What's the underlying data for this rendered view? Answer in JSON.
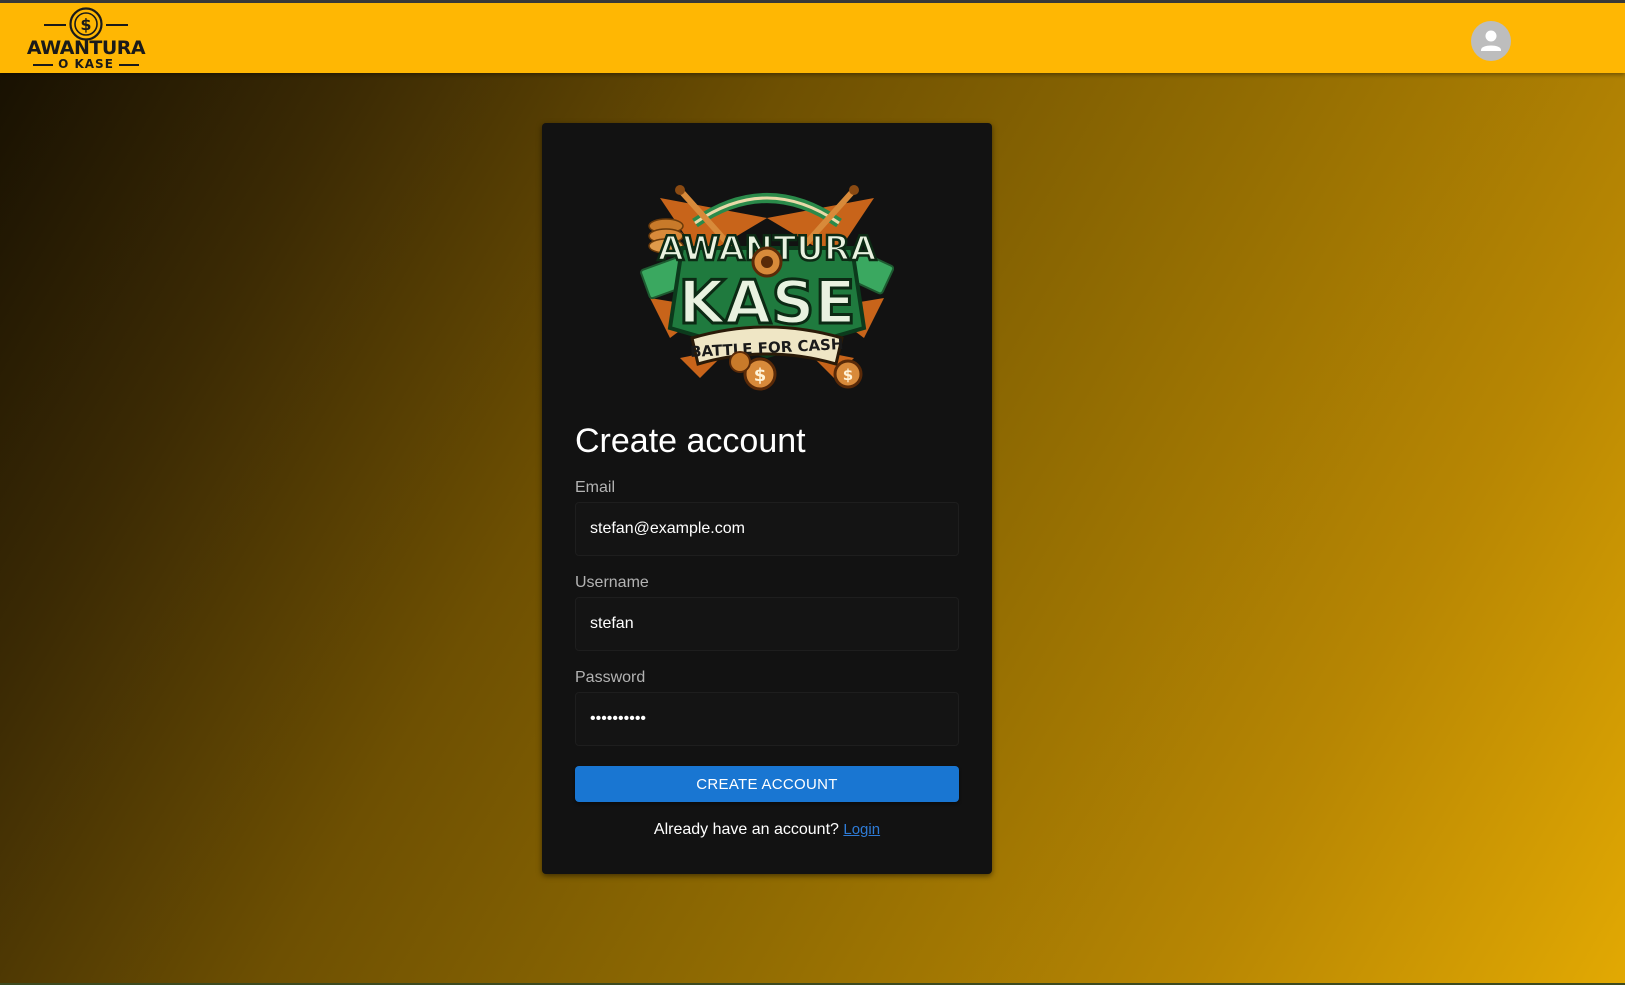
{
  "header": {
    "brand_word": "AWANTURA",
    "brand_sub": "O KASE",
    "avatar_icon": "account-icon",
    "accent_color": "#ffb703"
  },
  "card": {
    "logo": {
      "line1": "AWANTURA",
      "line2": "KASE",
      "tagline": "BATTLE FOR CASH"
    },
    "title": "Create account",
    "email": {
      "label": "Email",
      "value": "stefan@example.com"
    },
    "username": {
      "label": "Username",
      "value": "stefan"
    },
    "password": {
      "label": "Password",
      "value": "••••••••••"
    },
    "submit_label": "CREATE ACCOUNT",
    "footer_text": "Already have an account?",
    "login_link": "Login",
    "button_color": "#1976d2"
  }
}
